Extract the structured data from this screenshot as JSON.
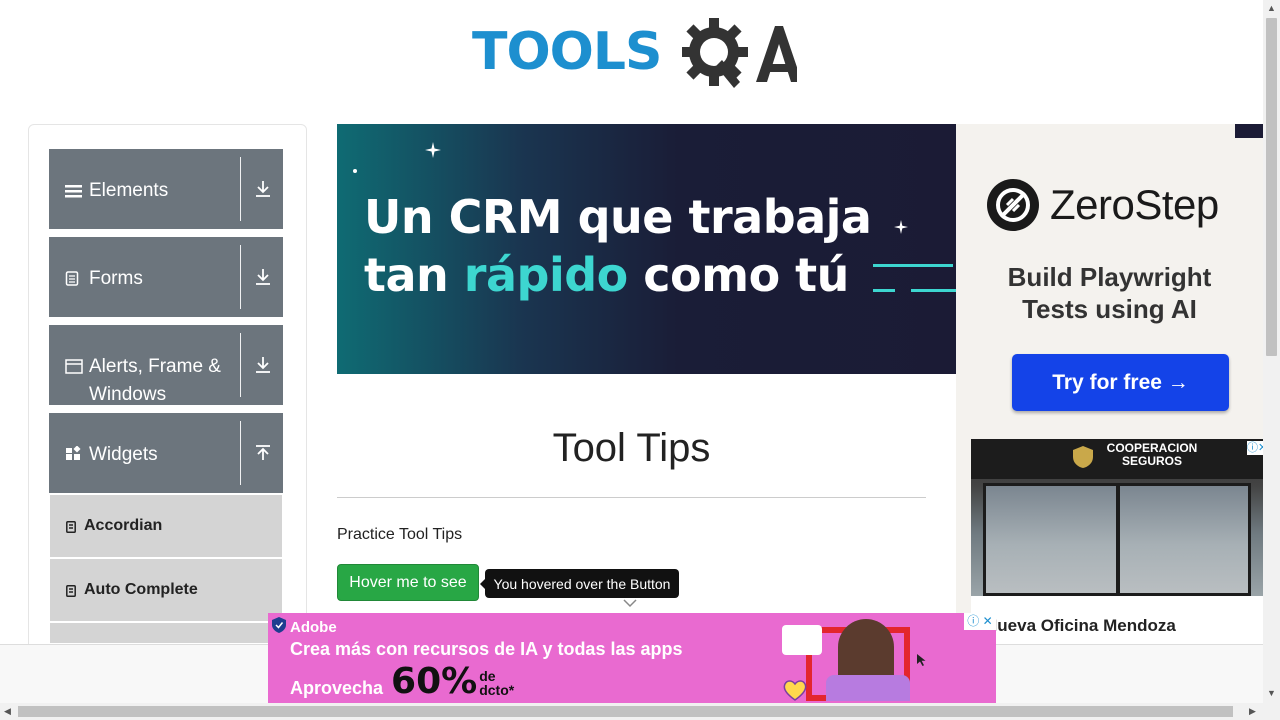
{
  "logo": {
    "text": "TOOLS",
    "suffix": "QA"
  },
  "sidebar": {
    "groups": [
      {
        "label": "Elements",
        "icon": "menu-icon",
        "toggle": "download-icon"
      },
      {
        "label": "Forms",
        "icon": "document-icon",
        "toggle": "download-icon"
      },
      {
        "label": "Alerts, Frame & Windows",
        "icon": "window-icon",
        "toggle": "download-icon"
      },
      {
        "label": "Widgets",
        "icon": "widgets-icon",
        "toggle": "upload-icon"
      }
    ],
    "widget_items": [
      {
        "label": "Accordian"
      },
      {
        "label": "Auto Complete"
      }
    ]
  },
  "banner_ad": {
    "line1": "Un CRM que trabaja",
    "line2_pre": "tan ",
    "line2_highlight": "rápido",
    "line2_post": " como tú",
    "accent_color": "#3dd6d0"
  },
  "right_ad": {
    "brand": "ZeroStep",
    "tagline_1": "Build Playwright",
    "tagline_2": "Tests using AI",
    "cta": "Try for free →",
    "cta_color": "#1443e8"
  },
  "photo_ad": {
    "sign": "COOPERACION SEGUROS",
    "caption": "Nueva Oficina Mendoza"
  },
  "main": {
    "title": "Tool Tips",
    "practice_label": "Practice Tool Tips",
    "hover_button": "Hover me to see",
    "tooltip": "You hovered over the Button",
    "button_color": "#28a745"
  },
  "bottom_ad": {
    "brand": "Adobe",
    "line1": "Crea más con recursos de IA y todas las apps",
    "line2": "Aprovecha",
    "percent": "60%",
    "suffix_1": "de",
    "suffix_2": "dcto*",
    "background": "#e96ad0"
  }
}
